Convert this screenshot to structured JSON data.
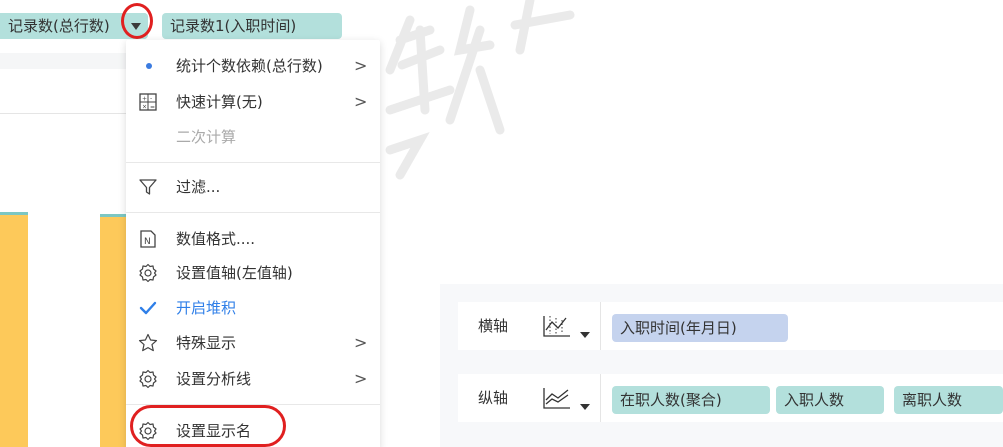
{
  "field_bar": {
    "records": "记录数(总行数)",
    "records1": "记录数1(入职时间)"
  },
  "menu": {
    "items": [
      {
        "label": "统计个数依赖(总行数)",
        "icon": "bullet-dot-icon",
        "submenu": true
      },
      {
        "label": "快速计算(无)",
        "icon": "calculator-icon",
        "submenu": true
      },
      {
        "label": "二次计算",
        "icon": "",
        "submenu": false,
        "disabled": true
      },
      {
        "label": "过滤...",
        "icon": "filter-icon",
        "submenu": false
      },
      {
        "label": "数值格式....",
        "icon": "number-format-icon",
        "submenu": false
      },
      {
        "label": "设置值轴(左值轴)",
        "icon": "gear-icon",
        "submenu": false
      },
      {
        "label": "开启堆积",
        "icon": "check-icon",
        "submenu": false,
        "active": true
      },
      {
        "label": "特殊显示",
        "icon": "star-icon",
        "submenu": true
      },
      {
        "label": "设置分析线",
        "icon": "gear-icon",
        "submenu": true
      },
      {
        "label": "设置显示名",
        "icon": "gear-icon",
        "submenu": false
      }
    ]
  },
  "axes": {
    "x_label": "横轴",
    "y_label": "纵轴",
    "x_fields": [
      "入职时间(年月日)"
    ],
    "y_fields": [
      "在职人数(聚合)",
      "入职人数",
      "离职人数"
    ]
  },
  "colors": {
    "pill_teal": "#b3e0dc",
    "pill_blue": "#c5d3ee",
    "bar_yellow": "#fdc95a",
    "accent_blue": "#2f7fe8",
    "highlight_red": "#e02020"
  }
}
